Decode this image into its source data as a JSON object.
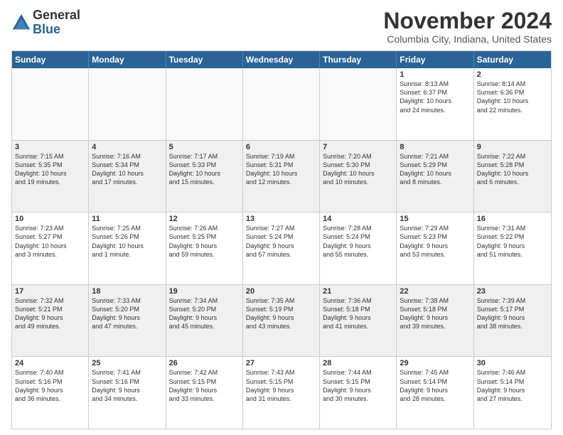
{
  "logo": {
    "general": "General",
    "blue": "Blue"
  },
  "title": "November 2024",
  "location": "Columbia City, Indiana, United States",
  "days": [
    "Sunday",
    "Monday",
    "Tuesday",
    "Wednesday",
    "Thursday",
    "Friday",
    "Saturday"
  ],
  "weeks": [
    [
      {
        "day": "",
        "info": ""
      },
      {
        "day": "",
        "info": ""
      },
      {
        "day": "",
        "info": ""
      },
      {
        "day": "",
        "info": ""
      },
      {
        "day": "",
        "info": ""
      },
      {
        "day": "1",
        "info": "Sunrise: 8:13 AM\nSunset: 6:37 PM\nDaylight: 10 hours\nand 24 minutes."
      },
      {
        "day": "2",
        "info": "Sunrise: 8:14 AM\nSunset: 6:36 PM\nDaylight: 10 hours\nand 22 minutes."
      }
    ],
    [
      {
        "day": "3",
        "info": "Sunrise: 7:15 AM\nSunset: 5:35 PM\nDaylight: 10 hours\nand 19 minutes."
      },
      {
        "day": "4",
        "info": "Sunrise: 7:16 AM\nSunset: 5:34 PM\nDaylight: 10 hours\nand 17 minutes."
      },
      {
        "day": "5",
        "info": "Sunrise: 7:17 AM\nSunset: 5:33 PM\nDaylight: 10 hours\nand 15 minutes."
      },
      {
        "day": "6",
        "info": "Sunrise: 7:19 AM\nSunset: 5:31 PM\nDaylight: 10 hours\nand 12 minutes."
      },
      {
        "day": "7",
        "info": "Sunrise: 7:20 AM\nSunset: 5:30 PM\nDaylight: 10 hours\nand 10 minutes."
      },
      {
        "day": "8",
        "info": "Sunrise: 7:21 AM\nSunset: 5:29 PM\nDaylight: 10 hours\nand 8 minutes."
      },
      {
        "day": "9",
        "info": "Sunrise: 7:22 AM\nSunset: 5:28 PM\nDaylight: 10 hours\nand 6 minutes."
      }
    ],
    [
      {
        "day": "10",
        "info": "Sunrise: 7:23 AM\nSunset: 5:27 PM\nDaylight: 10 hours\nand 3 minutes."
      },
      {
        "day": "11",
        "info": "Sunrise: 7:25 AM\nSunset: 5:26 PM\nDaylight: 10 hours\nand 1 minute."
      },
      {
        "day": "12",
        "info": "Sunrise: 7:26 AM\nSunset: 5:25 PM\nDaylight: 9 hours\nand 59 minutes."
      },
      {
        "day": "13",
        "info": "Sunrise: 7:27 AM\nSunset: 5:24 PM\nDaylight: 9 hours\nand 57 minutes."
      },
      {
        "day": "14",
        "info": "Sunrise: 7:28 AM\nSunset: 5:24 PM\nDaylight: 9 hours\nand 55 minutes."
      },
      {
        "day": "15",
        "info": "Sunrise: 7:29 AM\nSunset: 5:23 PM\nDaylight: 9 hours\nand 53 minutes."
      },
      {
        "day": "16",
        "info": "Sunrise: 7:31 AM\nSunset: 5:22 PM\nDaylight: 9 hours\nand 51 minutes."
      }
    ],
    [
      {
        "day": "17",
        "info": "Sunrise: 7:32 AM\nSunset: 5:21 PM\nDaylight: 9 hours\nand 49 minutes."
      },
      {
        "day": "18",
        "info": "Sunrise: 7:33 AM\nSunset: 5:20 PM\nDaylight: 9 hours\nand 47 minutes."
      },
      {
        "day": "19",
        "info": "Sunrise: 7:34 AM\nSunset: 5:20 PM\nDaylight: 9 hours\nand 45 minutes."
      },
      {
        "day": "20",
        "info": "Sunrise: 7:35 AM\nSunset: 5:19 PM\nDaylight: 9 hours\nand 43 minutes."
      },
      {
        "day": "21",
        "info": "Sunrise: 7:36 AM\nSunset: 5:18 PM\nDaylight: 9 hours\nand 41 minutes."
      },
      {
        "day": "22",
        "info": "Sunrise: 7:38 AM\nSunset: 5:18 PM\nDaylight: 9 hours\nand 39 minutes."
      },
      {
        "day": "23",
        "info": "Sunrise: 7:39 AM\nSunset: 5:17 PM\nDaylight: 9 hours\nand 38 minutes."
      }
    ],
    [
      {
        "day": "24",
        "info": "Sunrise: 7:40 AM\nSunset: 5:16 PM\nDaylight: 9 hours\nand 36 minutes."
      },
      {
        "day": "25",
        "info": "Sunrise: 7:41 AM\nSunset: 5:16 PM\nDaylight: 9 hours\nand 34 minutes."
      },
      {
        "day": "26",
        "info": "Sunrise: 7:42 AM\nSunset: 5:15 PM\nDaylight: 9 hours\nand 33 minutes."
      },
      {
        "day": "27",
        "info": "Sunrise: 7:43 AM\nSunset: 5:15 PM\nDaylight: 9 hours\nand 31 minutes."
      },
      {
        "day": "28",
        "info": "Sunrise: 7:44 AM\nSunset: 5:15 PM\nDaylight: 9 hours\nand 30 minutes."
      },
      {
        "day": "29",
        "info": "Sunrise: 7:45 AM\nSunset: 5:14 PM\nDaylight: 9 hours\nand 28 minutes."
      },
      {
        "day": "30",
        "info": "Sunrise: 7:46 AM\nSunset: 5:14 PM\nDaylight: 9 hours\nand 27 minutes."
      }
    ]
  ]
}
